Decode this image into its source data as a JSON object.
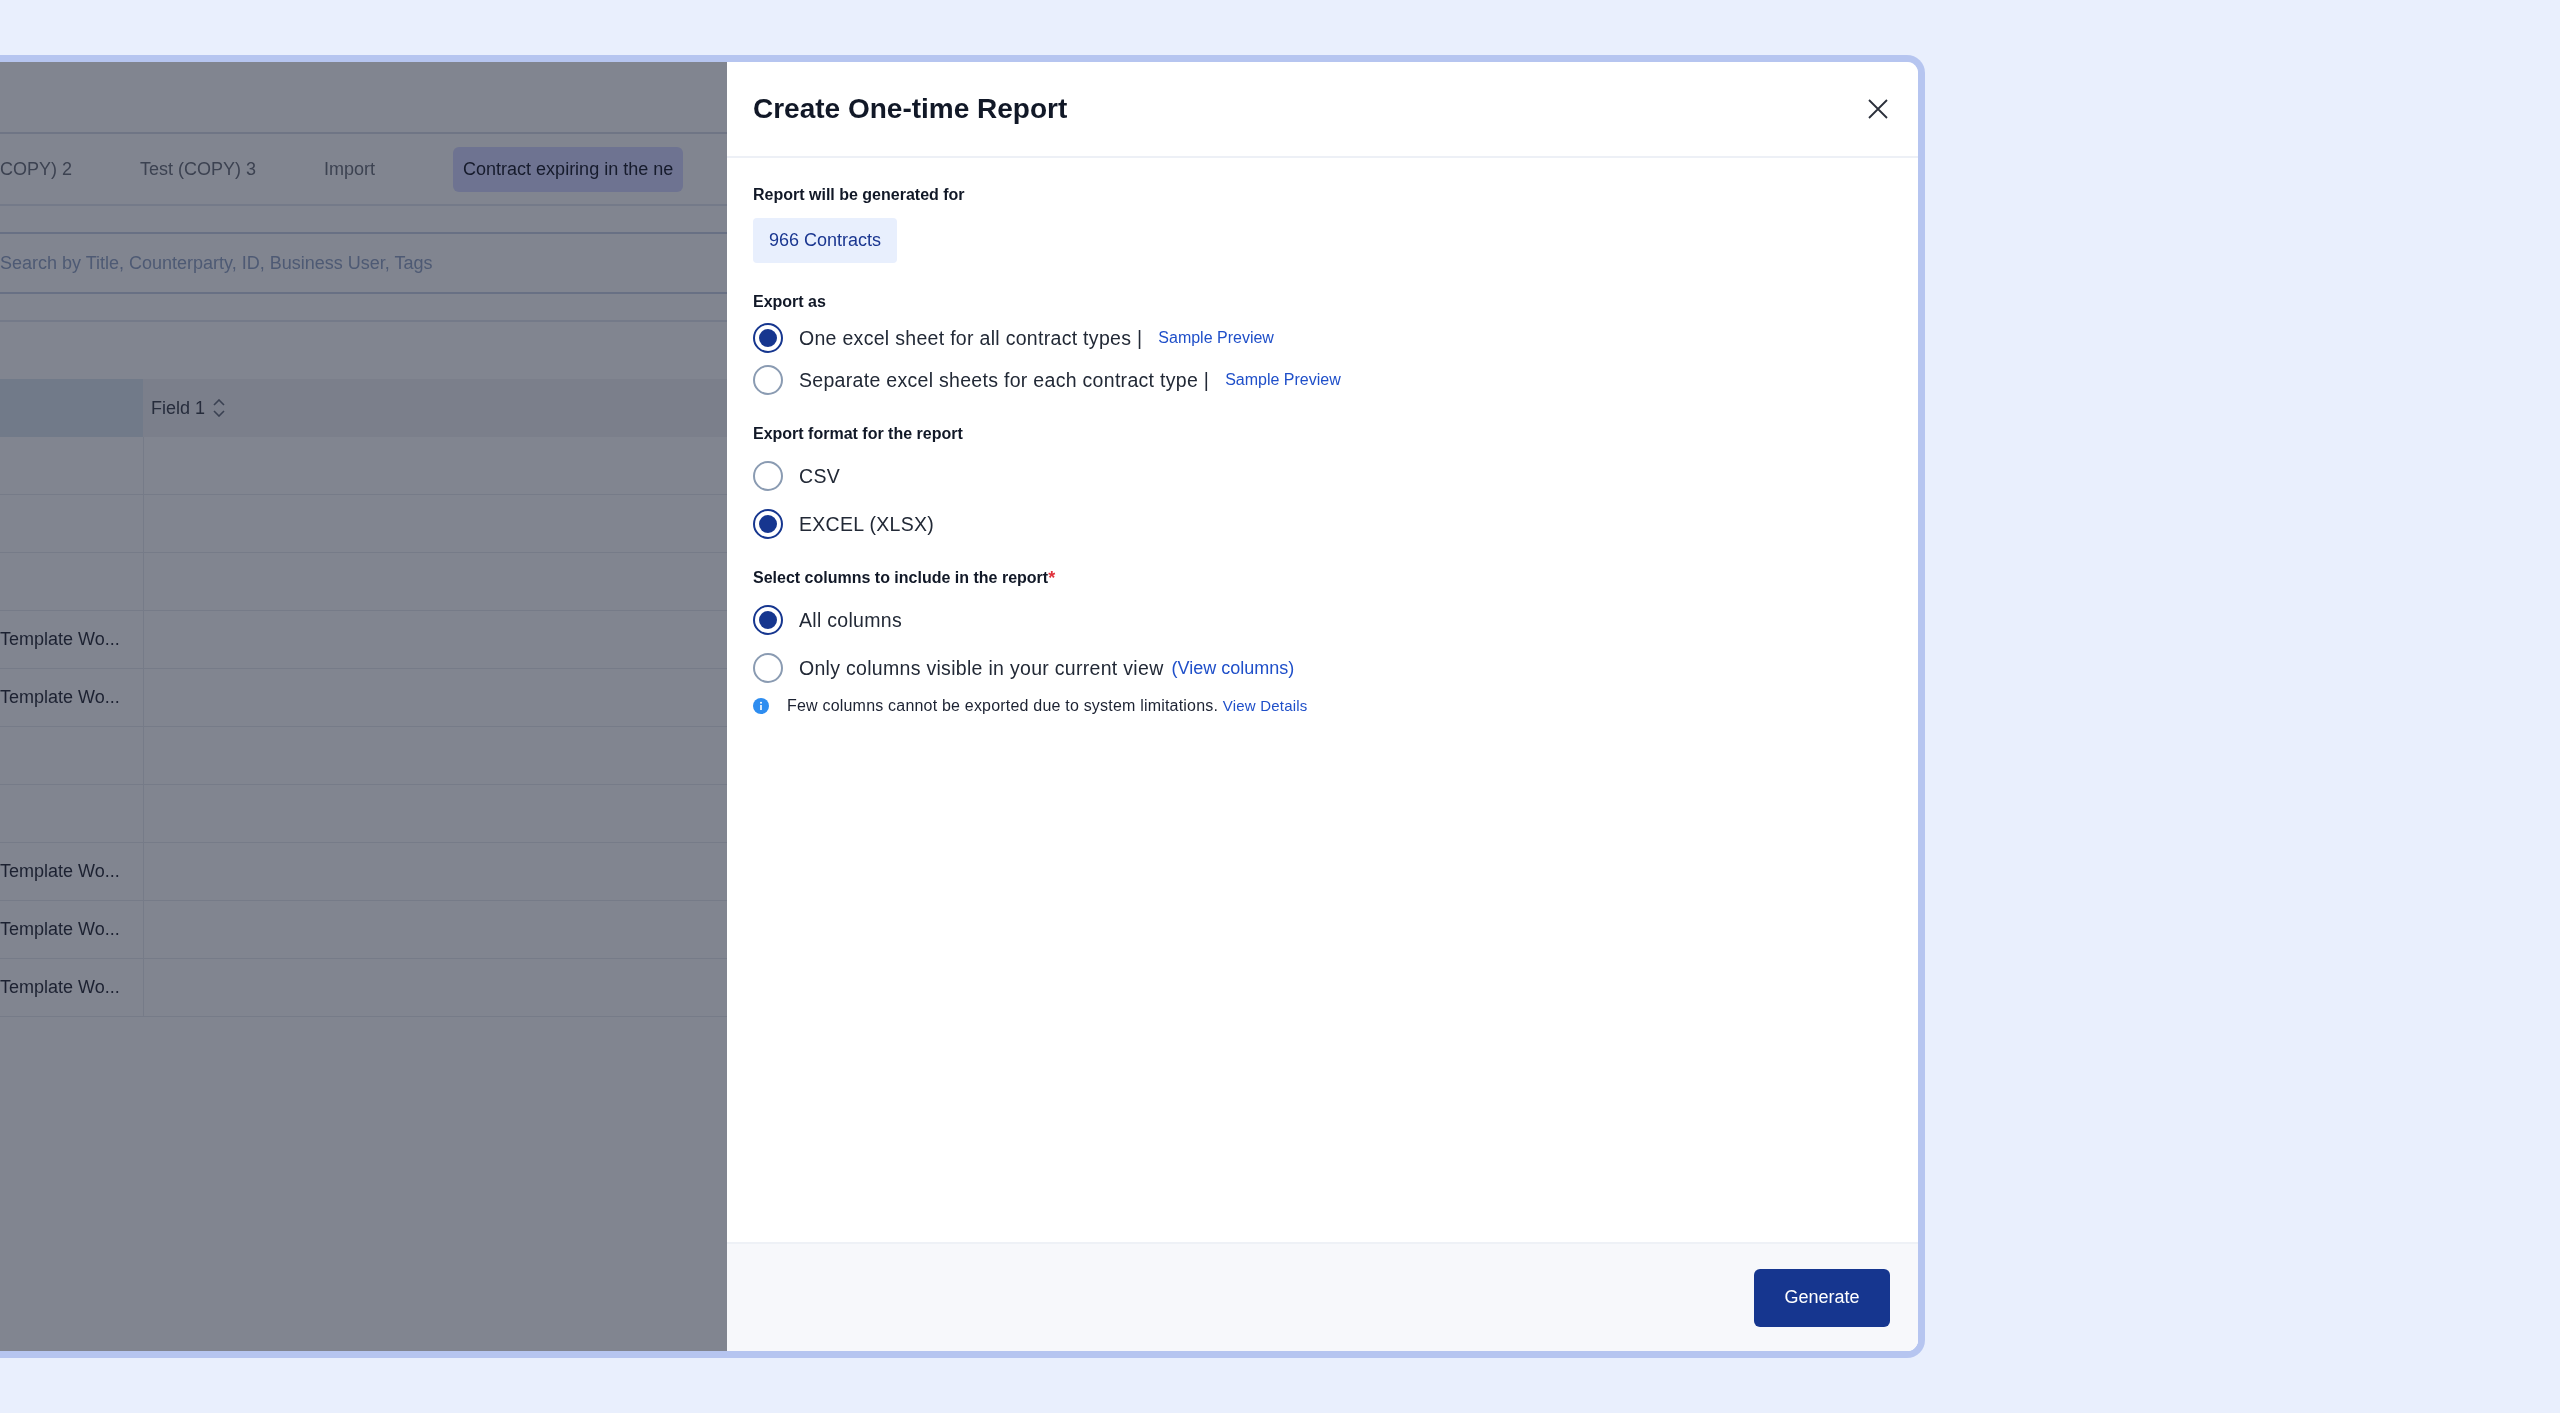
{
  "background": {
    "tabs": [
      {
        "label": "COPY) 2",
        "selected": false
      },
      {
        "label": "Test (COPY) 3",
        "selected": false
      },
      {
        "label": "Import",
        "selected": false
      },
      {
        "label": "Contract expiring in the ne",
        "selected": true
      }
    ],
    "search": {
      "placeholder": "Search by Title, Counterparty, ID, Business User, Tags"
    },
    "table": {
      "columns": [
        "Field 1"
      ],
      "rows": [
        {},
        {},
        {},
        {
          "column_1": "Template Wo..."
        },
        {
          "column_1": "Template Wo..."
        },
        {},
        {},
        {
          "column_1": "Template Wo..."
        },
        {
          "column_1": "Template Wo..."
        },
        {
          "column_1": "Template Wo..."
        }
      ]
    }
  },
  "dialog": {
    "title": "Create One-time Report",
    "target_label": "Report will be generated for",
    "target_count": "966 Contracts",
    "sections": [
      {
        "label": "Export as",
        "options": [
          {
            "label": "One excel sheet for all contract types |",
            "link": "Sample Preview",
            "selected": true
          },
          {
            "label": "Separate excel sheets for each contract type |",
            "link": "Sample Preview",
            "selected": false
          }
        ]
      },
      {
        "label": "Export format for the report",
        "options": [
          {
            "label": "CSV",
            "selected": false
          },
          {
            "label": "EXCEL (XLSX)",
            "selected": true
          }
        ]
      },
      {
        "label": "Select columns to include in the report",
        "required_mark": "*",
        "options": [
          {
            "label": "All columns",
            "selected": true
          },
          {
            "label": "Only columns visible in your current view",
            "link": "(View columns)",
            "selected": false
          }
        ],
        "note": {
          "text": "Few columns cannot be exported due to system limitations.",
          "link": "View Details"
        }
      }
    ],
    "primary_button": "Generate"
  }
}
